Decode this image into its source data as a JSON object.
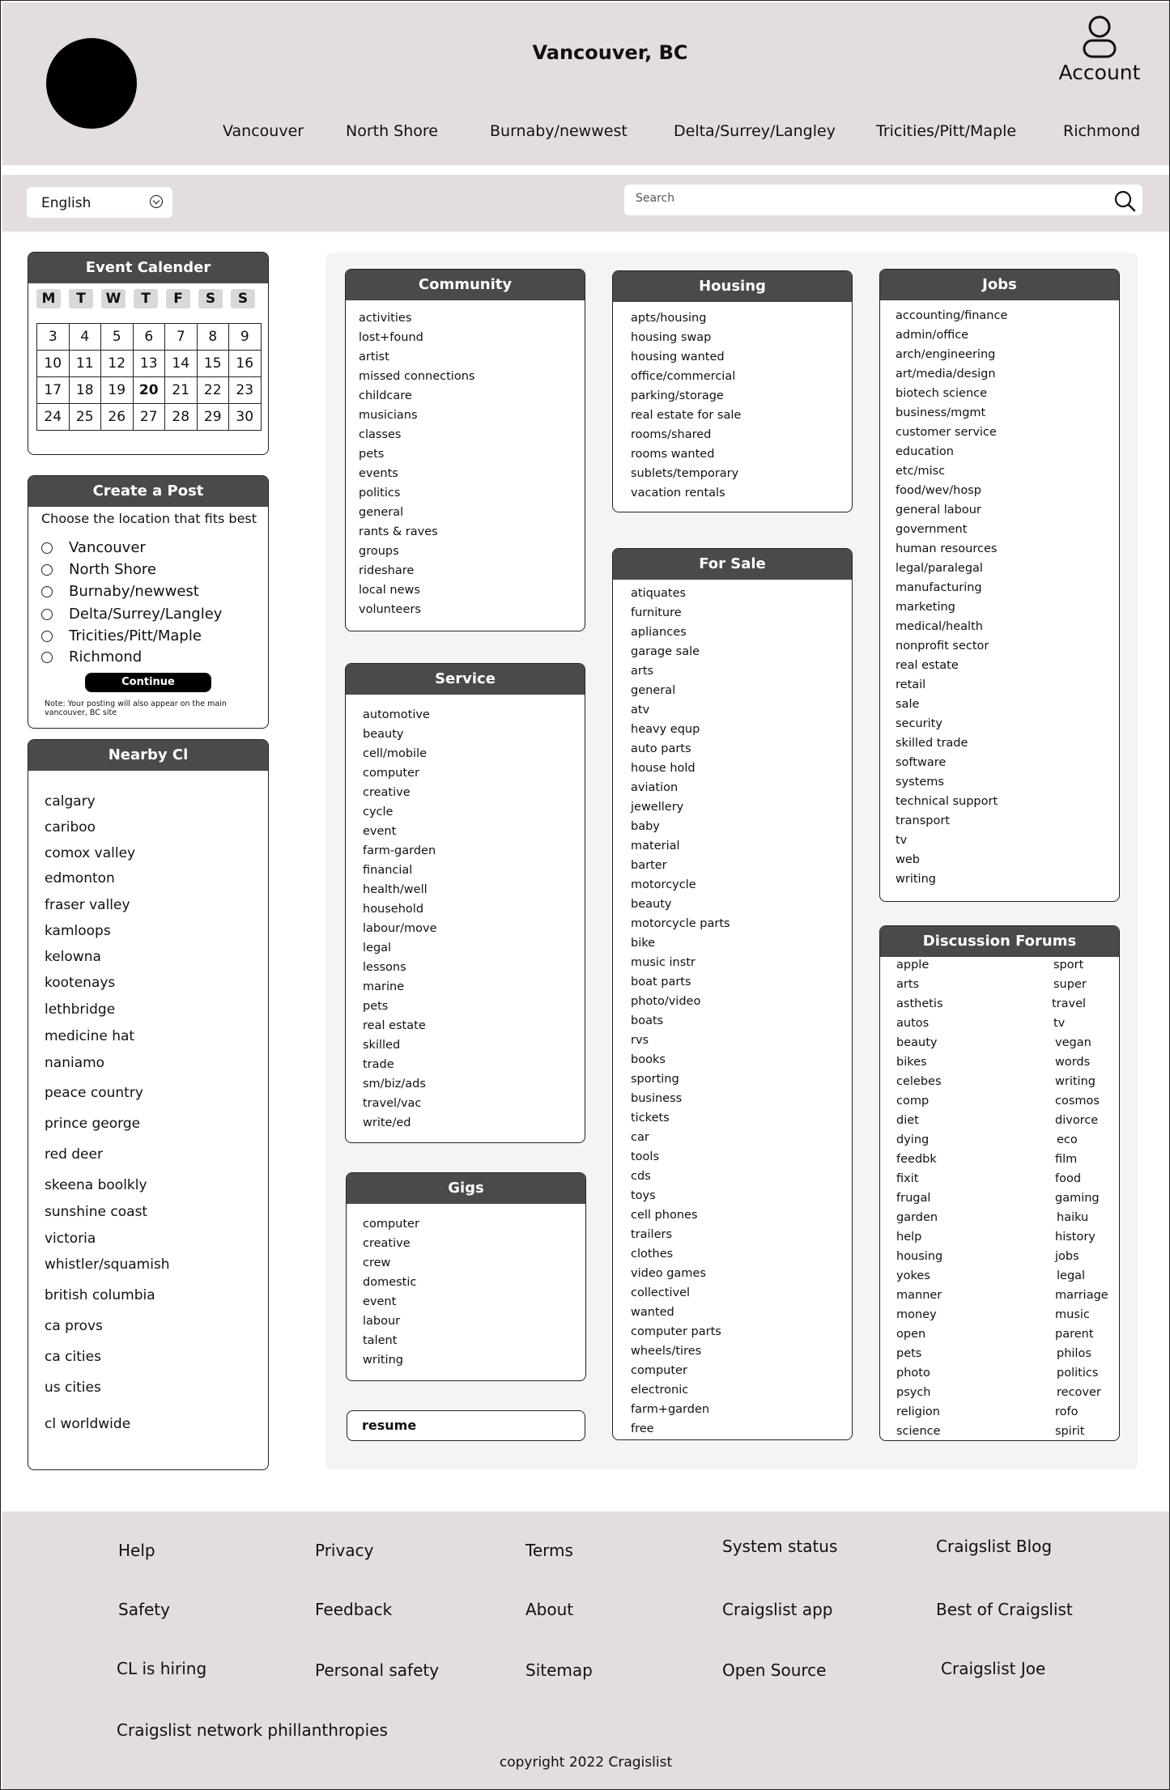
{
  "header": {
    "title": "Vancouver, BC",
    "account_label": "Account",
    "regions": [
      "Vancouver",
      "North Shore",
      "Burnaby/newwest",
      "Delta/Surrey/Langley",
      "Tricities/Pitt/Maple",
      "Richmond"
    ]
  },
  "toolbar": {
    "language": "English",
    "search_placeholder": "Search"
  },
  "calendar": {
    "title": "Event Calender",
    "days": [
      "M",
      "T",
      "W",
      "T",
      "F",
      "S",
      "S"
    ],
    "weeks": [
      [
        "3",
        "4",
        "5",
        "6",
        "7",
        "8",
        "9"
      ],
      [
        "10",
        "11",
        "12",
        "13",
        "14",
        "15",
        "16"
      ],
      [
        "17",
        "18",
        "19",
        "20",
        "21",
        "22",
        "23"
      ],
      [
        "24",
        "25",
        "26",
        "27",
        "28",
        "29",
        "30"
      ]
    ],
    "today": "20"
  },
  "create_post": {
    "title": "Create a Post",
    "prompt": "Choose the location that fits best",
    "options": [
      "Vancouver",
      "North Shore",
      "Burnaby/newwest",
      "Delta/Surrey/Langley",
      "Tricities/Pitt/Maple",
      "Richmond"
    ],
    "continue_label": "Continue",
    "note": "Note: Your posting will also appear on the main vancouver, BC site"
  },
  "nearby": {
    "title": "Nearby Cl",
    "items": [
      "calgary",
      "cariboo",
      "comox valley",
      "edmonton",
      "fraser valley",
      "kamloops",
      "kelowna",
      "kootenays",
      "lethbridge",
      "medicine hat",
      "naniamo",
      "peace country",
      "prince george",
      "red deer",
      "skeena boolkly",
      "sunshine coast",
      "victoria",
      "whistler/squamish",
      "british columbia",
      "ca provs",
      "ca cities",
      "us cities",
      "cl worldwide"
    ]
  },
  "community": {
    "title": "Community",
    "items": [
      "activities",
      " lost+found",
      "artist",
      "missed connections",
      "childcare",
      " musicians",
      "classes",
      "pets",
      "events",
      "politics",
      "general",
      "rants & raves",
      "groups",
      "rideshare",
      "local news",
      "volunteers"
    ]
  },
  "service": {
    "title": "Service",
    "items": [
      "automotive",
      "beauty",
      "cell/mobile",
      "computer",
      "creative",
      "cycle",
      "event",
      "farm-garden",
      "financial",
      "health/well",
      "household",
      "labour/move",
      "legal",
      "lessons",
      "marine",
      "pets",
      "real estate",
      "skilled",
      "trade",
      "sm/biz/ads",
      "travel/vac",
      "write/ed"
    ]
  },
  "gigs": {
    "title": "Gigs",
    "items": [
      "computer",
      "creative",
      "crew",
      "domestic",
      "event",
      "labour",
      "talent",
      "writing"
    ]
  },
  "resume": {
    "label": "resume"
  },
  "housing": {
    "title": "Housing",
    "items": [
      "apts/housing",
      "housing swap",
      "housing wanted",
      "office/commercial",
      "parking/storage",
      "real estate for sale",
      "rooms/shared",
      "rooms wanted",
      "sublets/temporary",
      "vacation rentals"
    ]
  },
  "for_sale": {
    "title": "For Sale",
    "items": [
      "atiquates",
      "furniture",
      "apliances",
      "garage sale",
      "arts",
      "general",
      "atv",
      "heavy equp",
      "auto parts",
      "house hold",
      "aviation",
      " jewellery",
      "baby",
      " material",
      "barter",
      "motorcycle",
      "beauty",
      " motorcycle parts",
      "bike",
      "music instr",
      "boat parts",
      "photo/video",
      "boats",
      "rvs",
      "books",
      "sporting",
      "business",
      "tickets",
      "car",
      " tools",
      "cds",
      "toys",
      "cell phones",
      "trailers",
      "clothes",
      "video games",
      "collectivel",
      "wanted",
      "computer parts",
      "wheels/tires",
      "computer",
      "electronic",
      "farm+garden",
      "free"
    ]
  },
  "jobs": {
    "title": "Jobs",
    "items": [
      "accounting/finance",
      "admin/office",
      "arch/engineering",
      "art/media/design",
      "biotech science",
      "business/mgmt",
      "customer service",
      "education",
      "etc/misc",
      "food/wev/hosp",
      "general labour",
      "government",
      "human resources",
      "legal/paralegal",
      "manufacturing",
      "marketing",
      "medical/health",
      "nonprofit sector",
      "real estate",
      "retail",
      "sale",
      "security",
      "skilled trade",
      "software",
      "systems",
      "technical support",
      "transport",
      "tv",
      "web",
      "writing"
    ]
  },
  "forums": {
    "title": "Discussion Forums",
    "left": [
      "apple",
      "arts",
      "asthetis",
      "autos",
      "beauty",
      "bikes",
      "celebes",
      "comp",
      "diet",
      "dying",
      "feedbk",
      "fixit",
      "frugal",
      "garden",
      "help",
      "housing",
      "yokes",
      "manner",
      "money",
      "open",
      "pets",
      "photo",
      "psych",
      "religion",
      "science"
    ],
    "right": [
      "sport",
      "super",
      "travel",
      "tv",
      "vegan",
      "words",
      "writing",
      "cosmos",
      "divorce",
      "eco",
      "film",
      "food",
      "gaming",
      "haiku",
      "history",
      "jobs",
      "legal",
      "marriage",
      "music",
      "parent",
      "philos",
      "politics",
      "recover",
      "rofo",
      "spirit"
    ]
  },
  "footer": {
    "links": [
      "Help",
      "Privacy",
      "Terms",
      "System status",
      "Craigslist Blog",
      "Safety",
      "Feedback",
      "About",
      "Craigslist app",
      "Best of Craigslist",
      "CL is hiring",
      "Personal safety",
      "Sitemap",
      "Open Source",
      "Craigslist Joe",
      "Craigslist network phillanthropies"
    ],
    "copyright": "copyright 2022 Cragislist"
  }
}
